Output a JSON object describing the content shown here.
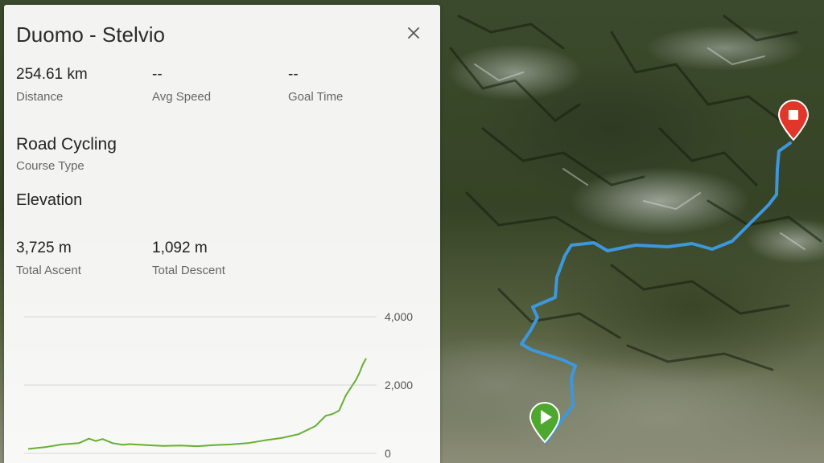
{
  "course": {
    "title": "Duomo - Stelvio",
    "distance": {
      "value": "254.61 km",
      "label": "Distance"
    },
    "avg_speed": {
      "value": "--",
      "label": "Avg Speed"
    },
    "goal_time": {
      "value": "--",
      "label": "Goal Time"
    },
    "course_type": {
      "value": "Road Cycling",
      "label": "Course Type"
    },
    "elevation_title": "Elevation",
    "total_ascent": {
      "value": "3,725 m",
      "label": "Total Ascent"
    },
    "total_descent": {
      "value": "1,092 m",
      "label": "Total Descent"
    }
  },
  "icons": {
    "close": "close-icon",
    "start": "play-icon",
    "finish": "stop-icon"
  },
  "colors": {
    "route": "#3d97dc",
    "elevation_line": "#66b032",
    "start_marker": "#4ea72e",
    "finish_marker": "#e3362b"
  },
  "chart_data": {
    "type": "line",
    "title": "",
    "xlabel": "",
    "ylabel": "",
    "y_ticks": [
      "4,000",
      "2,000",
      "0"
    ],
    "ylim": [
      0,
      4000
    ],
    "grid": true,
    "series": [
      {
        "x": [
          0,
          5,
          10,
          15,
          18,
          20,
          22,
          25,
          28,
          30,
          35,
          40,
          45,
          50,
          55,
          60,
          65,
          70,
          75,
          80,
          85,
          88,
          90,
          92,
          94,
          96,
          97,
          98,
          99,
          100
        ],
        "values": [
          130,
          180,
          260,
          300,
          430,
          360,
          420,
          300,
          250,
          270,
          240,
          220,
          230,
          210,
          240,
          260,
          300,
          380,
          450,
          560,
          800,
          1100,
          1150,
          1250,
          1700,
          2000,
          2150,
          2350,
          2600,
          2780
        ]
      }
    ]
  }
}
